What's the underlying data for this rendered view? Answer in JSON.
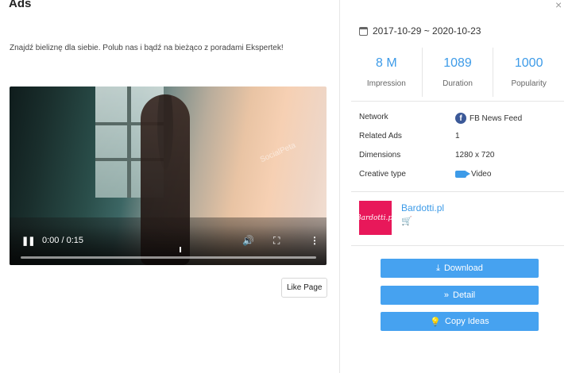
{
  "header": {
    "title": "Ads",
    "close_glyph": "×"
  },
  "ad": {
    "description": "Znajdź bieliznę dla siebie. Polub nas i bądź na bieżąco z poradami Ekspertek!",
    "watermark": "SocialPeta",
    "video": {
      "play_glyph": "❚❚",
      "time": "0:00 / 0:15",
      "volume_glyph": "🔊",
      "fullscreen_glyph": "⛶",
      "more_glyph": "⋮",
      "progress": 0.0
    },
    "cta_label": "Like Page"
  },
  "details": {
    "date_range": "2017-10-29 ~ 2020-10-23",
    "stats": [
      {
        "value": "8 M",
        "label": "Impression"
      },
      {
        "value": "1089",
        "label": "Duration"
      },
      {
        "value": "1000",
        "label": "Popularity"
      }
    ],
    "rows": [
      {
        "key": "Network",
        "value": "FB News Feed",
        "icon": "facebook-icon"
      },
      {
        "key": "Related Ads",
        "value": "1",
        "icon": ""
      },
      {
        "key": "Dimensions",
        "value": "1280 x 720",
        "icon": ""
      },
      {
        "key": "Creative type",
        "value": "Video",
        "icon": "video-camera-icon"
      }
    ],
    "advertiser": {
      "logo_text": "Bardotti.pl",
      "name": "Bardotti.pl",
      "cart_glyph": "🛒"
    },
    "buttons": [
      {
        "label": "Download",
        "glyph": "⤓",
        "icon": "download-icon"
      },
      {
        "label": "Detail",
        "glyph": "»",
        "icon": "double-chevron-icon"
      },
      {
        "label": "Copy Ideas",
        "glyph": "💡",
        "icon": "lightbulb-icon"
      }
    ]
  },
  "colors": {
    "accent": "#3d9be8",
    "button": "#46a2f0",
    "brand": "#e8185a",
    "cart": "#f5b400"
  }
}
